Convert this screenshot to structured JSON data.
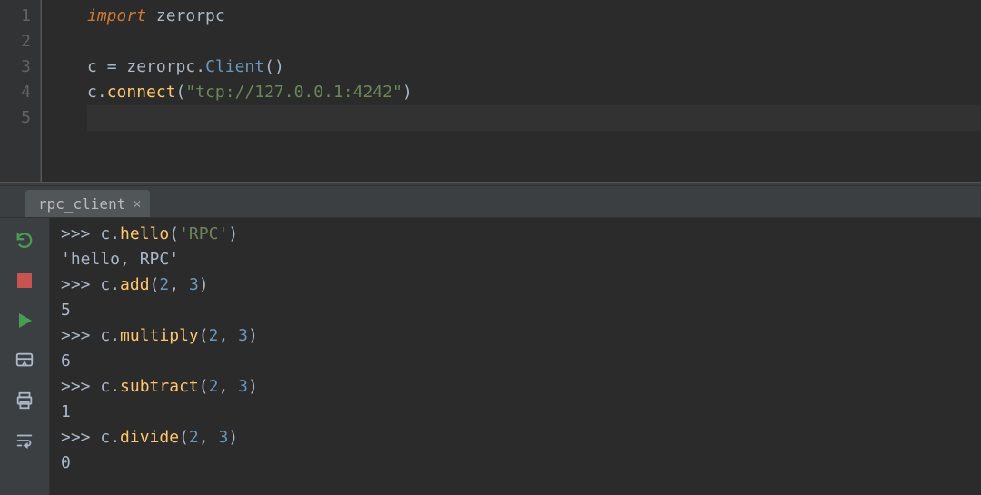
{
  "editor": {
    "line_numbers": [
      "1",
      "2",
      "3",
      "4",
      "5"
    ],
    "lines": {
      "l1": {
        "kw": "import",
        "space": " ",
        "mod": "zerorpc"
      },
      "l2": "",
      "l3": {
        "v": "c",
        "sp": " ",
        "eq": "=",
        "sp2": " ",
        "obj": "zerorpc",
        "dot": ".",
        "cls": "Client",
        "lp": "(",
        "rp": ")"
      },
      "l4": {
        "v": "c",
        "dot": ".",
        "fn": "connect",
        "lp": "(",
        "str": "\"tcp://127.0.0.1:4242\"",
        "rp": ")"
      },
      "l5": ""
    }
  },
  "tab": {
    "label": "rpc_client"
  },
  "console": {
    "prompt": ">>> ",
    "lines": [
      {
        "type": "in",
        "obj": "c",
        "dot": ".",
        "fn": "hello",
        "lp": "(",
        "arg": "'RPC'",
        "rp": ")"
      },
      {
        "type": "out",
        "text": "'hello, RPC'"
      },
      {
        "type": "in",
        "obj": "c",
        "dot": ".",
        "fn": "add",
        "lp": "(",
        "a1": "2",
        "comma": ", ",
        "a2": "3",
        "rp": ")"
      },
      {
        "type": "out",
        "text": "5"
      },
      {
        "type": "in",
        "obj": "c",
        "dot": ".",
        "fn": "multiply",
        "lp": "(",
        "a1": "2",
        "comma": ", ",
        "a2": "3",
        "rp": ")"
      },
      {
        "type": "out",
        "text": "6"
      },
      {
        "type": "in",
        "obj": "c",
        "dot": ".",
        "fn": "subtract",
        "lp": "(",
        "a1": "2",
        "comma": ", ",
        "a2": "3",
        "rp": ")"
      },
      {
        "type": "out",
        "text": "1"
      },
      {
        "type": "in",
        "obj": "c",
        "dot": ".",
        "fn": "divide",
        "lp": "(",
        "a1": "2",
        "comma": ", ",
        "a2": "3",
        "rp": ")"
      },
      {
        "type": "out",
        "text": "0"
      }
    ]
  },
  "icons": {
    "rerun": "rerun-icon",
    "stop": "stop-icon",
    "run": "run-icon",
    "layout": "layout-icon",
    "print": "print-icon",
    "wrap": "wrap-icon"
  }
}
